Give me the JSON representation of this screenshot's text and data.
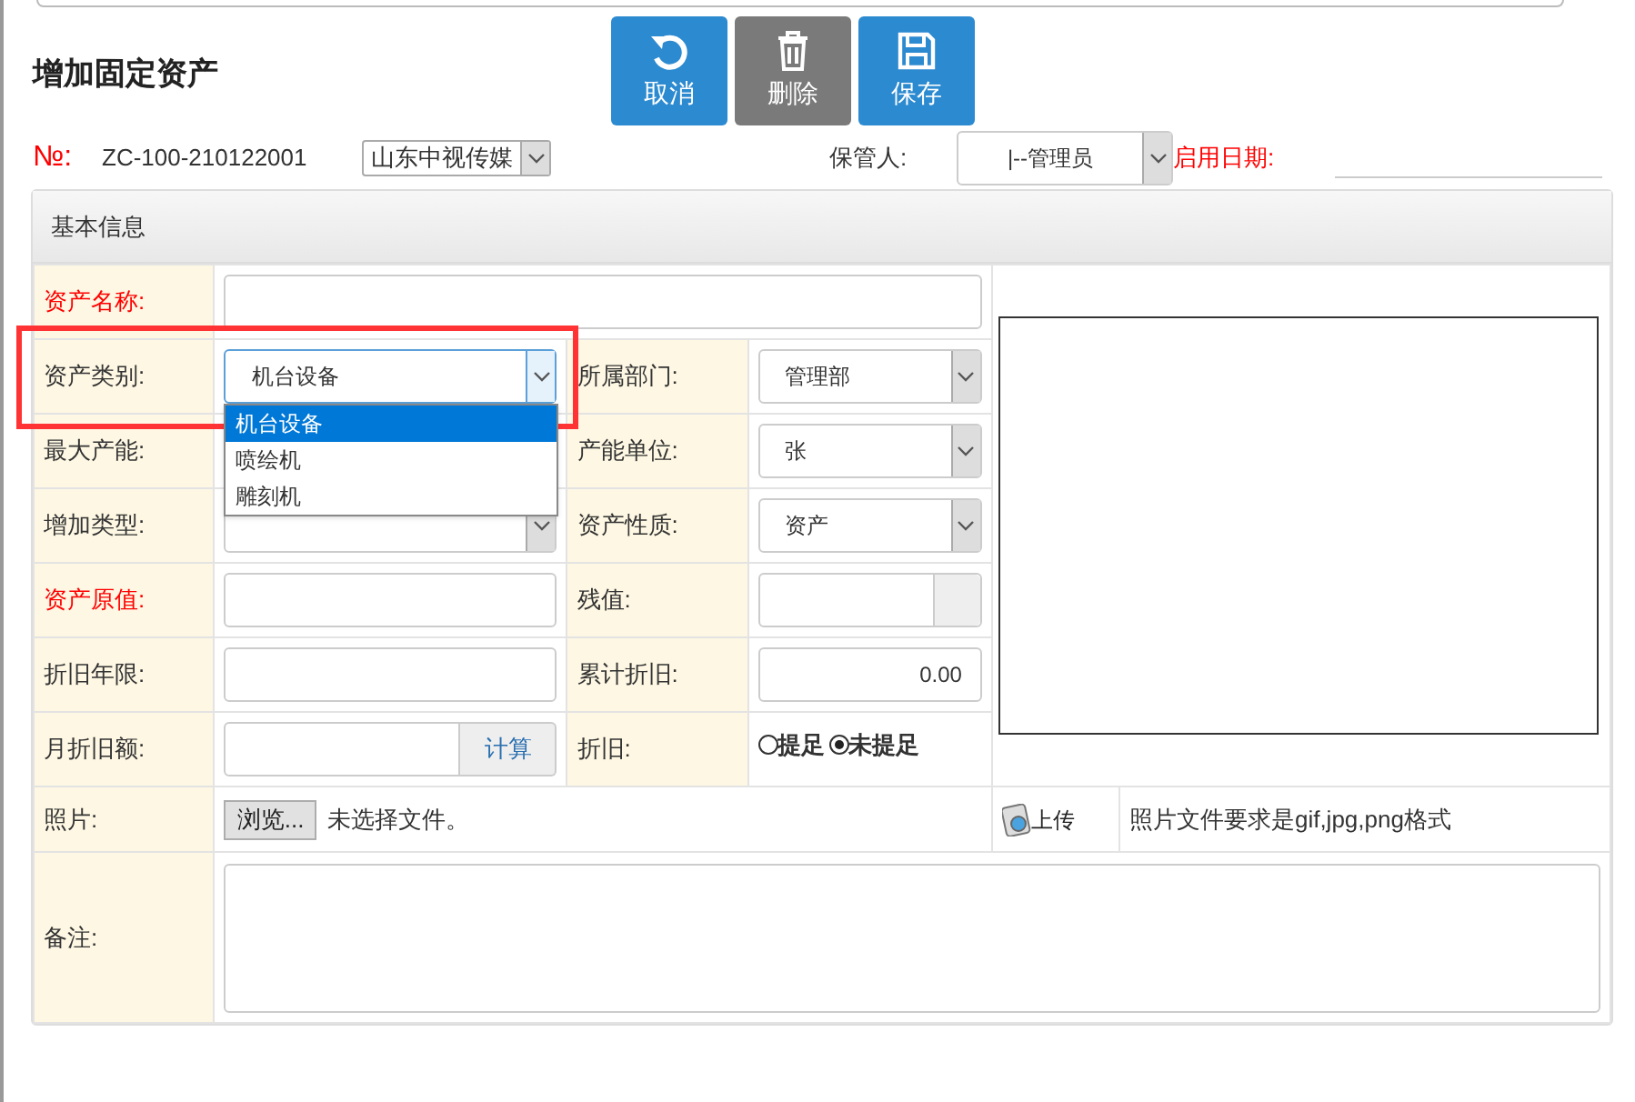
{
  "page_title": "增加固定资产",
  "toolbar": [
    {
      "kind": "cancel",
      "label": "取消",
      "disabled": false
    },
    {
      "kind": "delete",
      "label": "删除",
      "disabled": true
    },
    {
      "kind": "save",
      "label": "保存",
      "disabled": false
    }
  ],
  "header": {
    "no_label": "№:",
    "no_value": "ZC-100-210122001",
    "company": "山东中视传媒",
    "keeper_label": "保管人:",
    "keeper": "|--管理员",
    "start_date_label": "启用日期:"
  },
  "panel_title": "基本信息",
  "form": {
    "asset_name": {
      "label": "资产名称:",
      "required": true
    },
    "asset_category": {
      "label": "资产类别:",
      "required": false,
      "value": "机台设备",
      "expanded": true,
      "options": [
        {
          "label": "机台设备",
          "selected": true
        },
        {
          "label": "喷绘机",
          "selected": false
        },
        {
          "label": "雕刻机",
          "selected": false
        }
      ]
    },
    "department": {
      "label": "所属部门:",
      "value": "管理部"
    },
    "max_capacity": {
      "label": "最大产能:"
    },
    "capacity_unit": {
      "label": "产能单位:",
      "value": "张"
    },
    "add_type": {
      "label": "增加类型:"
    },
    "asset_nature": {
      "label": "资产性质:",
      "value": "资产"
    },
    "original_value": {
      "label": "资产原值:",
      "required": true
    },
    "residual_value": {
      "label": "残值:"
    },
    "depreciation_years": {
      "label": "折旧年限:"
    },
    "accumulated_depreciation": {
      "label": "累计折旧:",
      "value": "0.00"
    },
    "monthly_depreciation": {
      "label": "月折旧额:",
      "button": "计算"
    },
    "depreciation": {
      "label": "折旧:",
      "options": [
        {
          "label": "提足",
          "selected": false
        },
        {
          "label": "未提足",
          "selected": true
        }
      ]
    },
    "photo": {
      "label": "照片:",
      "browse": "浏览...",
      "file_status": "未选择文件。",
      "upload": "上传",
      "hint": "照片文件要求是gif,jpg,png格式"
    },
    "remarks": {
      "label": "备注:"
    }
  }
}
